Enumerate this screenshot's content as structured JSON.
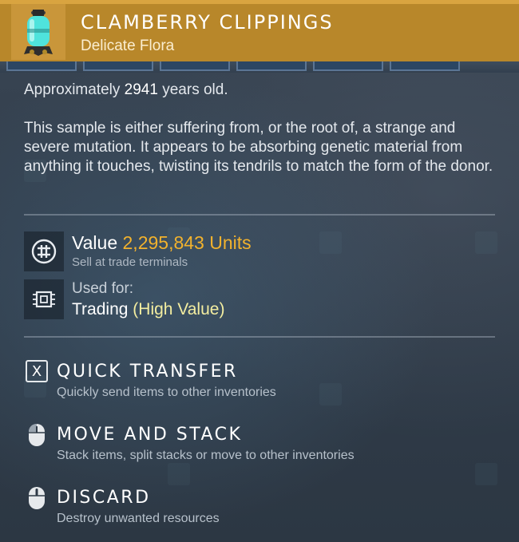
{
  "item": {
    "title": "CLAMBERRY CLIPPINGS",
    "category": "Delicate Flora",
    "icon": "canister-icon"
  },
  "age": {
    "prefix": "Approximately",
    "number": "2941",
    "suffix": "years old."
  },
  "description": "This sample is either suffering from, or the root of, a strange and severe mutation. It appears to be absorbing genetic material from anything it touches, twisting its tendrils to match the form of the donor.",
  "value": {
    "label": "Value",
    "amount": "2,295,843 Units",
    "sub": "Sell at trade terminals",
    "icon": "units-currency-icon"
  },
  "used_for": {
    "label": "Used for:",
    "value": "Trading",
    "highlight": "(High Value)",
    "icon": "chip-icon"
  },
  "actions": [
    {
      "key": "X",
      "title": "QUICK TRANSFER",
      "subtitle": "Quickly send items to other inventories",
      "icon": "x-key-icon"
    },
    {
      "title": "MOVE AND STACK",
      "subtitle": "Stack items, split stacks or move to other inventories",
      "icon": "mouse-left-click-icon"
    },
    {
      "title": "DISCARD",
      "subtitle": "Destroy unwanted resources",
      "icon": "mouse-click-icon"
    }
  ],
  "colors": {
    "header": "#b8872a",
    "value_accent": "#f2b22d",
    "highlight": "#f3eda0"
  }
}
